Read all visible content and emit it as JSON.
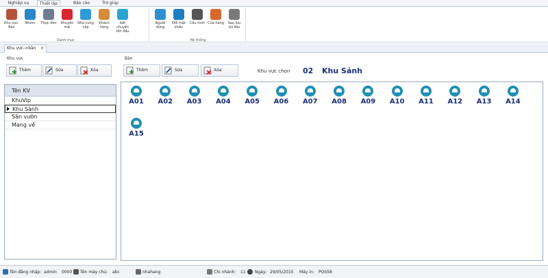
{
  "menu": {
    "tabs": [
      "Nghiệp vụ",
      "Thiết lập",
      "Báo cáo",
      "Trợ giúp"
    ]
  },
  "ribbon": {
    "danh_muc": {
      "label": "Danh mục",
      "buttons": [
        {
          "label": "Khu vực-Bàn",
          "icon": "area-table-icon",
          "color": "#b5523b"
        },
        {
          "label": "Nhóm",
          "icon": "group-icon",
          "color": "#2a86c9"
        },
        {
          "label": "Thực đơn",
          "icon": "menu-icon",
          "color": "#6b7c93"
        },
        {
          "label": "Khuyến mãi",
          "icon": "promotion-icon",
          "color": "#d8262e"
        },
        {
          "label": "Nhà cung cấp",
          "icon": "supplier-icon",
          "color": "#2f9bd6"
        },
        {
          "label": "Khách hàng",
          "icon": "customer-icon",
          "color": "#d88b3a"
        },
        {
          "label": "Kết chuyển tồn đầu",
          "icon": "transfer-icon",
          "color": "#2aa4cf"
        }
      ]
    },
    "he_thong": {
      "label": "Hệ thống",
      "buttons": [
        {
          "label": "Người dùng",
          "icon": "user-icon",
          "color": "#2f8fd0"
        },
        {
          "label": "Đổi mật khẩu",
          "icon": "password-icon",
          "color": "#1e7fc0"
        },
        {
          "label": "Cấu hình",
          "icon": "config-icon",
          "color": "#555555"
        },
        {
          "label": "Cửa hàng",
          "icon": "store-icon",
          "color": "#d8682e"
        },
        {
          "label": "Sao lưu dữ liệu",
          "icon": "backup-icon",
          "color": "#7a7a7a"
        }
      ]
    }
  },
  "doc_tab": {
    "label": "Khu vực->bàn",
    "close": "×"
  },
  "left": {
    "title": "Khu vực",
    "buttons": {
      "add": "Thêm",
      "edit": "Sửa",
      "delete": "Xóa"
    },
    "header": "Tên KV",
    "rows": [
      "KhuVip",
      "Khu Sảnh",
      "Sân vườn",
      "Mang về"
    ],
    "selected_index": 1
  },
  "right": {
    "title": "Bàn",
    "buttons": {
      "add": "Thêm",
      "edit": "Sửa",
      "delete": "Xóa"
    },
    "area_label": "Khu vực chọn",
    "area_code": "02",
    "area_name": "Khu Sảnh",
    "tables": [
      "A01",
      "A02",
      "A03",
      "A04",
      "A05",
      "A06",
      "A07",
      "A08",
      "A09",
      "A10",
      "A11",
      "A12",
      "A13",
      "A14",
      "A15"
    ]
  },
  "status": {
    "login_label": "Tên đăng nhập:",
    "login_value": "admin",
    "code": "0000",
    "server_label": "Tên máy chủ:",
    "server_value": "abc",
    "db_value": "nhahang",
    "branch_label": "Chi nhánh:",
    "branch_value": "11",
    "date_label": "Ngày:",
    "date_value": "29/05/2015",
    "machine_label": "Máy in:",
    "machine_value": "POS58"
  }
}
